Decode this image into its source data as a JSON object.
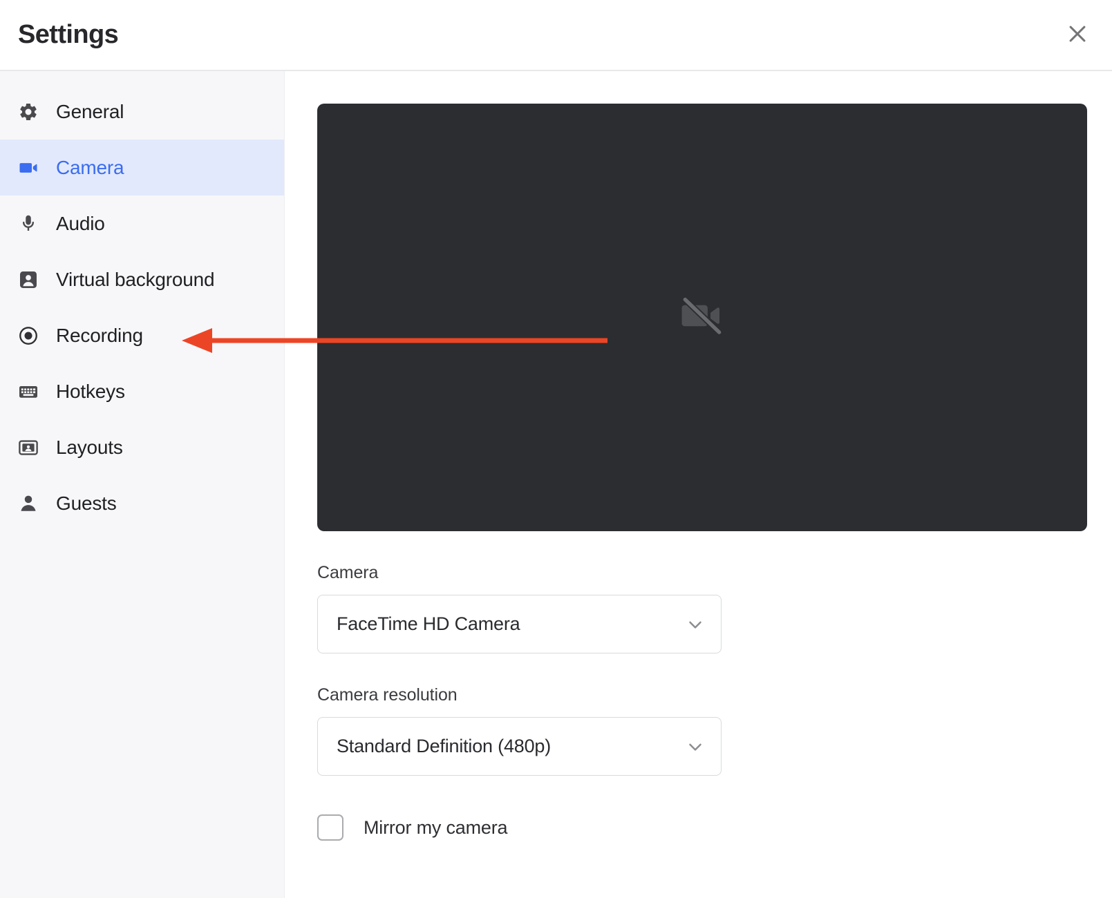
{
  "header": {
    "title": "Settings",
    "close_icon": "close-icon"
  },
  "sidebar": {
    "items": [
      {
        "label": "General",
        "icon": "gear-icon",
        "active": false
      },
      {
        "label": "Camera",
        "icon": "video-camera-icon",
        "active": true
      },
      {
        "label": "Audio",
        "icon": "microphone-icon",
        "active": false
      },
      {
        "label": "Virtual background",
        "icon": "person-card-icon",
        "active": false
      },
      {
        "label": "Recording",
        "icon": "record-dot-icon",
        "active": false
      },
      {
        "label": "Hotkeys",
        "icon": "keyboard-icon",
        "active": false
      },
      {
        "label": "Layouts",
        "icon": "layout-person-icon",
        "active": false
      },
      {
        "label": "Guests",
        "icon": "person-icon",
        "active": false
      }
    ]
  },
  "main": {
    "preview": {
      "icon": "camera-off-icon"
    },
    "camera_field": {
      "label": "Camera",
      "value": "FaceTime HD Camera",
      "chevron_icon": "chevron-down-icon"
    },
    "resolution_field": {
      "label": "Camera resolution",
      "value": "Standard Definition (480p)",
      "chevron_icon": "chevron-down-icon"
    },
    "mirror_checkbox": {
      "label": "Mirror my camera",
      "checked": false
    }
  },
  "annotation": {
    "name": "arrow-pointing-to-recording",
    "color": "#ec4526",
    "points_to": "Recording"
  },
  "colors": {
    "accent_blue": "#3a6df0",
    "active_row_bg": "#e3e9fc",
    "sidebar_bg": "#f7f7f9",
    "preview_bg": "#2c2d30",
    "annotation_red": "#ec4526"
  }
}
